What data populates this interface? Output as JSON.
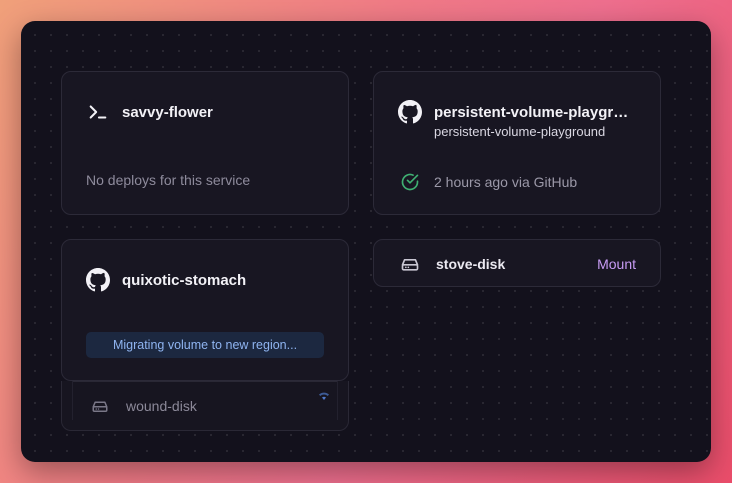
{
  "services": [
    {
      "name": "savvy-flower",
      "icon": "terminal-icon",
      "status": "No deploys for this service"
    },
    {
      "name": "persistent-volume-playground",
      "icon": "github-icon",
      "repo": "persistent-volume-playground",
      "deploy_status": "2 hours ago via GitHub",
      "status_icon": "check-circle-icon",
      "status_color": "#3fb072"
    },
    {
      "name": "quixotic-stomach",
      "icon": "github-icon",
      "banner": "Migrating volume to new region..."
    }
  ],
  "volumes": [
    {
      "name": "stove-disk",
      "icon": "disk-icon",
      "action": "Mount",
      "action_color": "#c89cf5"
    },
    {
      "name": "wound-disk",
      "icon": "disk-icon",
      "indicator_icon": "wifi-icon"
    }
  ],
  "colors": {
    "canvas": "#13111c",
    "card": "#181622",
    "banner_bg": "#1c2840",
    "banner_text": "#8fb4f0"
  }
}
